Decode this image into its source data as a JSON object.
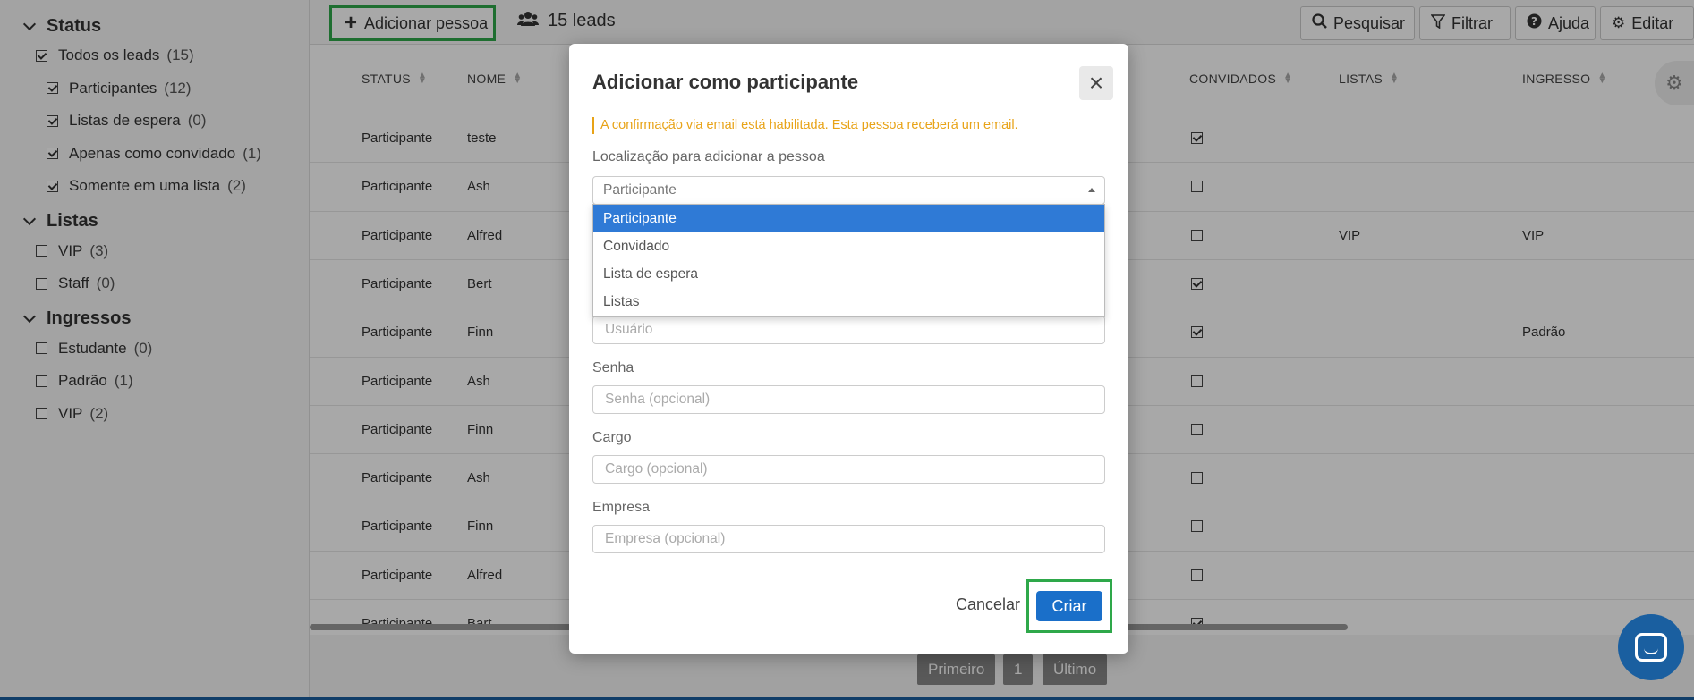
{
  "sidebar": {
    "status": {
      "title": "Status",
      "items": [
        {
          "label": "Todos os leads",
          "count": "(15)",
          "checked": true
        },
        {
          "label": "Participantes",
          "count": "(12)",
          "checked": true
        },
        {
          "label": "Listas de espera",
          "count": "(0)",
          "checked": true
        },
        {
          "label": "Apenas como convidado",
          "count": "(1)",
          "checked": true
        },
        {
          "label": "Somente em uma lista",
          "count": "(2)",
          "checked": true
        }
      ]
    },
    "listas": {
      "title": "Listas",
      "items": [
        {
          "label": "VIP",
          "count": "(3)",
          "checked": false
        },
        {
          "label": "Staff",
          "count": "(0)",
          "checked": false
        }
      ]
    },
    "ingressos": {
      "title": "Ingressos",
      "items": [
        {
          "label": "Estudante",
          "count": "(0)",
          "checked": false
        },
        {
          "label": "Padrão",
          "count": "(1)",
          "checked": false
        },
        {
          "label": "VIP",
          "count": "(2)",
          "checked": false
        }
      ]
    }
  },
  "toolbar": {
    "add_label": "Adicionar pessoa",
    "leads_label": "15 leads",
    "search_label": "Pesquisar",
    "filter_label": "Filtrar",
    "help_label": "Ajuda",
    "edit_label": "Editar"
  },
  "table": {
    "headers": {
      "status": "STATUS",
      "nome": "NOME",
      "convidados": "CONVIDADOS",
      "listas": "LISTAS",
      "ingresso": "INGRESSO"
    },
    "rows": [
      {
        "status": "Participante",
        "nome": "teste",
        "convidado": true,
        "lista": "",
        "ingresso": ""
      },
      {
        "status": "Participante",
        "nome": "Ash",
        "convidado": false,
        "lista": "",
        "ingresso": ""
      },
      {
        "status": "Participante",
        "nome": "Alfred",
        "convidado": false,
        "lista": "VIP",
        "ingresso": "VIP"
      },
      {
        "status": "Participante",
        "nome": "Bert",
        "convidado": true,
        "lista": "",
        "ingresso": ""
      },
      {
        "status": "Participante",
        "nome": "Finn",
        "convidado": true,
        "lista": "",
        "ingresso": "Padrão"
      },
      {
        "status": "Participante",
        "nome": "Ash",
        "convidado": false,
        "lista": "",
        "ingresso": ""
      },
      {
        "status": "Participante",
        "nome": "Finn",
        "convidado": false,
        "lista": "",
        "ingresso": ""
      },
      {
        "status": "Participante",
        "nome": "Ash",
        "convidado": false,
        "lista": "",
        "ingresso": ""
      },
      {
        "status": "Participante",
        "nome": "Finn",
        "convidado": false,
        "lista": "",
        "ingresso": ""
      },
      {
        "status": "Participante",
        "nome": "Alfred",
        "convidado": false,
        "lista": "",
        "ingresso": ""
      },
      {
        "status": "Participante",
        "nome": "Bart",
        "convidado": true,
        "lista": "",
        "ingresso": ""
      }
    ]
  },
  "pagination": {
    "first": "Primeiro",
    "page": "1",
    "last": "Último"
  },
  "modal": {
    "title": "Adicionar como participante",
    "notice": "A confirmação via email está habilitada. Esta pessoa receberá um email.",
    "location_label": "Localização para adicionar a pessoa",
    "location_value": "Participante",
    "location_options": [
      "Participante",
      "Convidado",
      "Lista de espera",
      "Listas"
    ],
    "user_placeholder": "Usuário",
    "password_label": "Senha",
    "password_placeholder": "Senha (opcional)",
    "role_label": "Cargo",
    "role_placeholder": "Cargo (opcional)",
    "company_label": "Empresa",
    "company_placeholder": "Empresa (opcional)",
    "cancel_label": "Cancelar",
    "create_label": "Criar"
  },
  "colors": {
    "highlight": "#2ea84a",
    "primary": "#1a6fc9",
    "notice": "#e8a317",
    "selected_option": "#2f7ad6"
  }
}
